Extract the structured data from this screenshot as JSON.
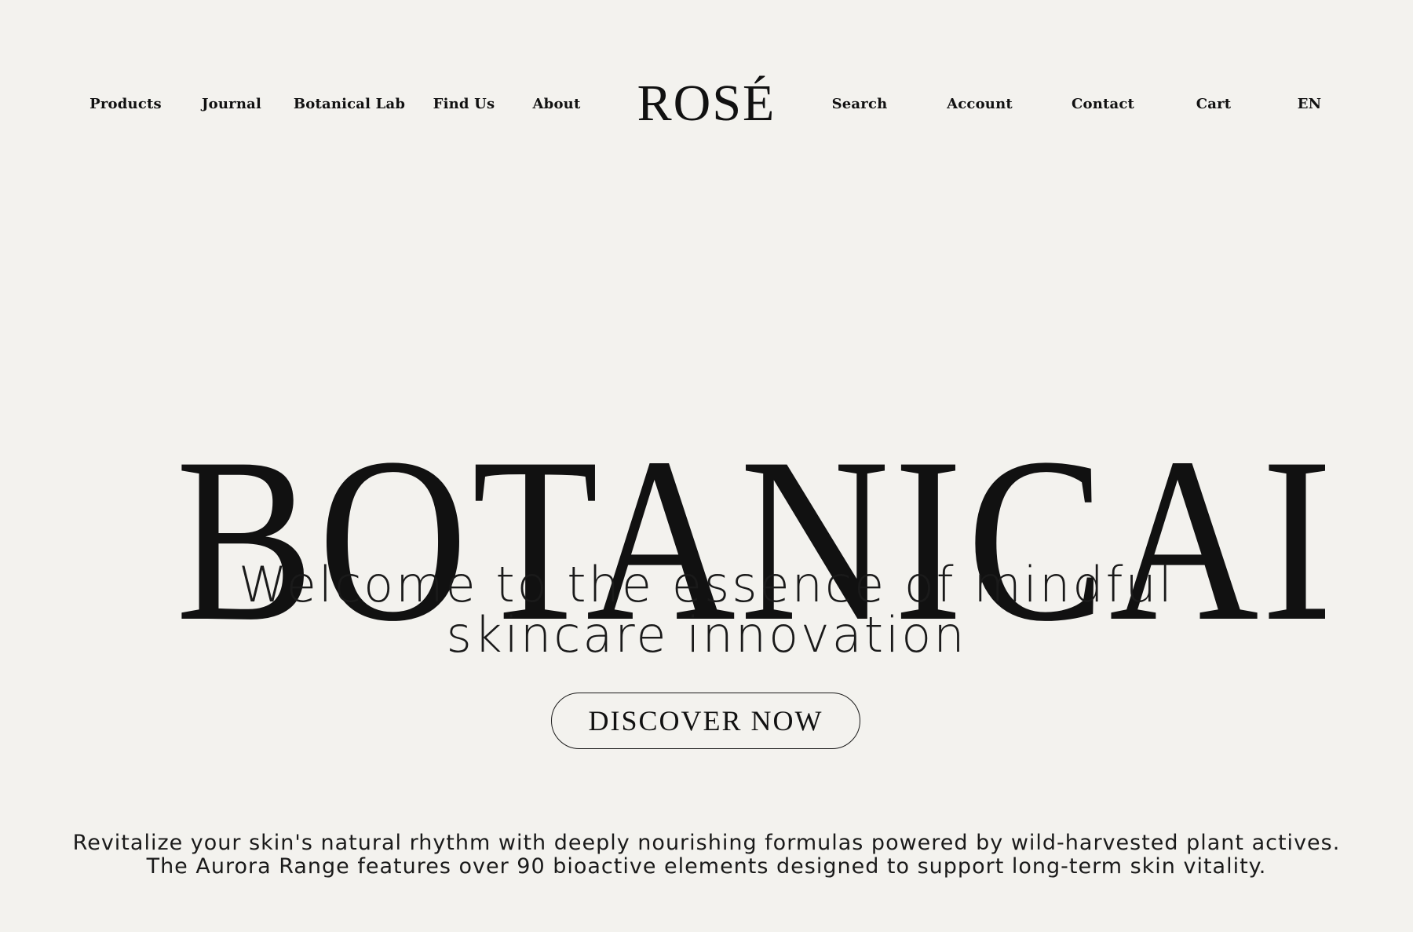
{
  "nav": {
    "left_links": [
      "Products",
      "Journal",
      "Botanical Lab",
      "Find Us",
      "About"
    ],
    "brand": "ROSÉ",
    "right_links": [
      "Search",
      "Account",
      "Contact",
      "Cart",
      "EN"
    ]
  },
  "hero": {
    "title": "BOTANICAL",
    "subtitle_line1": "Welcome to the essence of mindful",
    "subtitle_line2": "skincare innovation",
    "cta_label": "DISCOVER NOW"
  },
  "description": {
    "line1": "Revitalize your skin's natural rhythm with deeply nourishing formulas powered by wild-harvested plant actives.",
    "line2": "The Aurora Range features over 90 bioactive elements designed to support long-term skin vitality."
  },
  "colors": {
    "background": "#f3f2ee",
    "text": "#111111"
  }
}
